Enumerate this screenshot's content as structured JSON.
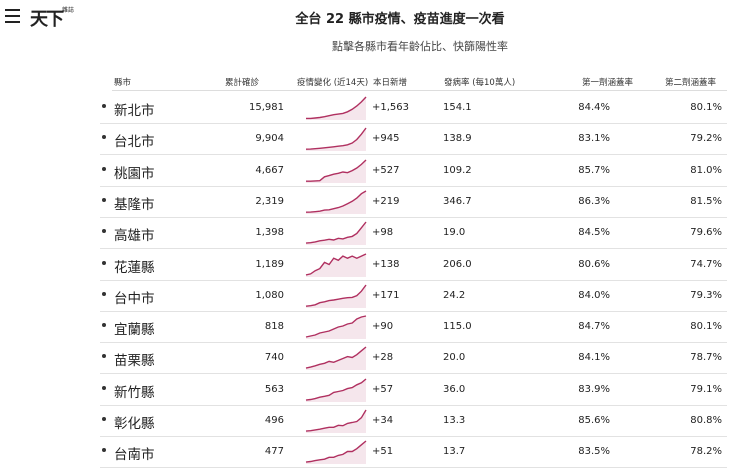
{
  "header": {
    "title": "全台 22 縣市疫情、疫苗進度一次看",
    "subtitle": "點擊各縣市看年齡佔比、快篩陽性率",
    "logo": "天下",
    "logo_sub": "雜誌"
  },
  "columns": [
    "縣市",
    "累計確診",
    "疫情變化 (近14天)",
    "本日新增",
    "發病率 (每10萬人)",
    "第一劑涵蓋率",
    "第二劑涵蓋率"
  ],
  "accent": "#b03060",
  "rows": [
    {
      "name": "新北市",
      "cum": "15,981",
      "new": "+1,563",
      "rate": "154.1",
      "d1": "84.4%",
      "d2": "80.1%",
      "trend": [
        1,
        1,
        1.2,
        1.5,
        2,
        2.6,
        3.2,
        3.6,
        4,
        5,
        6.5,
        8.5,
        11,
        14
      ]
    },
    {
      "name": "台北市",
      "cum": "9,904",
      "new": "+945",
      "rate": "138.9",
      "d1": "83.1%",
      "d2": "79.2%",
      "trend": [
        1,
        1.1,
        1.3,
        1.5,
        1.8,
        2.1,
        2.4,
        2.7,
        3,
        3.5,
        4.5,
        6.5,
        9.5,
        13
      ]
    },
    {
      "name": "桃園市",
      "cum": "4,667",
      "new": "+527",
      "rate": "109.2",
      "d1": "85.7%",
      "d2": "81.0%",
      "trend": [
        1,
        1,
        1.2,
        1.3,
        3.5,
        4.2,
        5,
        5.5,
        6.2,
        5.8,
        7,
        8.5,
        10.5,
        13
      ]
    },
    {
      "name": "基隆市",
      "cum": "2,319",
      "new": "+219",
      "rate": "346.7",
      "d1": "86.3%",
      "d2": "81.5%",
      "trend": [
        1,
        1.1,
        1.3,
        1.6,
        2.2,
        2.4,
        3,
        3.6,
        4.5,
        5.8,
        7.2,
        9,
        11.5,
        13
      ]
    },
    {
      "name": "高雄市",
      "cum": "1,398",
      "new": "+98",
      "rate": "19.0",
      "d1": "84.5%",
      "d2": "79.6%",
      "trend": [
        1,
        1.2,
        1.6,
        2.2,
        2.5,
        3,
        2.6,
        3.5,
        3.2,
        4,
        4.5,
        6,
        9,
        12
      ]
    },
    {
      "name": "花蓮縣",
      "cum": "1,189",
      "new": "+138",
      "rate": "206.0",
      "d1": "80.6%",
      "d2": "74.7%",
      "trend": [
        1,
        1.5,
        3,
        4,
        7,
        6,
        9,
        8,
        10,
        9,
        10,
        9,
        10,
        11
      ]
    },
    {
      "name": "台中市",
      "cum": "1,080",
      "new": "+171",
      "rate": "24.2",
      "d1": "84.0%",
      "d2": "79.3%",
      "trend": [
        1,
        1.3,
        1.8,
        3,
        3.5,
        4.2,
        4.5,
        5,
        5.5,
        5.8,
        6,
        7,
        9.5,
        13
      ]
    },
    {
      "name": "宜蘭縣",
      "cum": "818",
      "new": "+90",
      "rate": "115.0",
      "d1": "84.7%",
      "d2": "80.1%",
      "trend": [
        1,
        1.5,
        2,
        3,
        3.5,
        4,
        5,
        6,
        6.5,
        7.5,
        8,
        10,
        11,
        11.5
      ]
    },
    {
      "name": "苗栗縣",
      "cum": "740",
      "new": "+28",
      "rate": "20.0",
      "d1": "84.1%",
      "d2": "78.7%",
      "trend": [
        1,
        1.5,
        2.2,
        3,
        3.5,
        4.5,
        4,
        5,
        6,
        7,
        6.5,
        8,
        10,
        12
      ]
    },
    {
      "name": "新竹縣",
      "cum": "563",
      "new": "+57",
      "rate": "36.0",
      "d1": "83.9%",
      "d2": "79.1%",
      "trend": [
        1,
        1.3,
        1.8,
        2.5,
        3,
        3.5,
        5,
        5.5,
        6,
        7,
        7.5,
        9,
        10,
        12
      ]
    },
    {
      "name": "彰化縣",
      "cum": "496",
      "new": "+34",
      "rate": "13.3",
      "d1": "85.6%",
      "d2": "80.8%",
      "trend": [
        1,
        1.2,
        1.6,
        2,
        2.5,
        3,
        3,
        4,
        3.8,
        5,
        5.5,
        6,
        8,
        12
      ]
    },
    {
      "name": "台南市",
      "cum": "477",
      "new": "+51",
      "rate": "13.7",
      "d1": "83.5%",
      "d2": "78.2%",
      "trend": [
        1,
        1.3,
        1.8,
        2.2,
        2.5,
        3.5,
        3.5,
        4.5,
        5,
        6.5,
        6.5,
        8,
        10,
        12
      ]
    }
  ]
}
